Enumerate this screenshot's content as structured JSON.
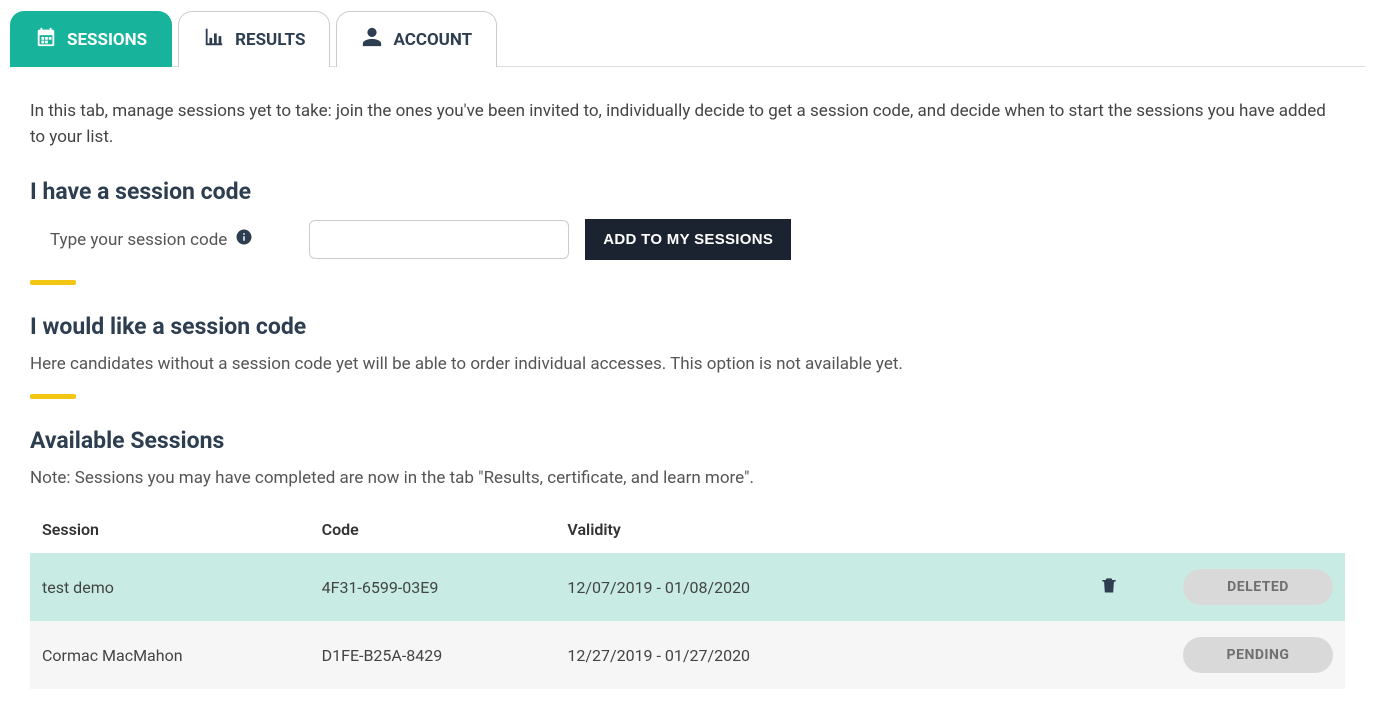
{
  "tabs": [
    {
      "label": "SESSIONS",
      "icon": "calendar",
      "active": true
    },
    {
      "label": "RESULTS",
      "icon": "chart",
      "active": false
    },
    {
      "label": "ACCOUNT",
      "icon": "user",
      "active": false
    }
  ],
  "intro": "In this tab, manage sessions yet to take: join the ones you've been invited to, individually decide to get a session code, and decide when to start the sessions you have added to your list.",
  "section_have_code": {
    "heading": "I have a session code",
    "input_label": "Type your session code",
    "input_value": "",
    "button_label": "ADD TO MY SESSIONS"
  },
  "section_want_code": {
    "heading": "I would like a session code",
    "description": "Here candidates without a session code yet will be able to order individual accesses. This option is not available yet."
  },
  "section_available": {
    "heading": "Available Sessions",
    "note": "Note: Sessions you may have completed are now in the tab \"Results, certificate, and learn more\"."
  },
  "table": {
    "headers": {
      "session": "Session",
      "code": "Code",
      "validity": "Validity"
    },
    "rows": [
      {
        "session": "test demo",
        "code": "4F31-6599-03E9",
        "validity": "12/07/2019 - 01/08/2020",
        "deletable": true,
        "status": "DELETED"
      },
      {
        "session": "Cormac MacMahon",
        "code": "D1FE-B25A-8429",
        "validity": "12/27/2019 - 01/27/2020",
        "deletable": false,
        "status": "PENDING"
      }
    ]
  }
}
